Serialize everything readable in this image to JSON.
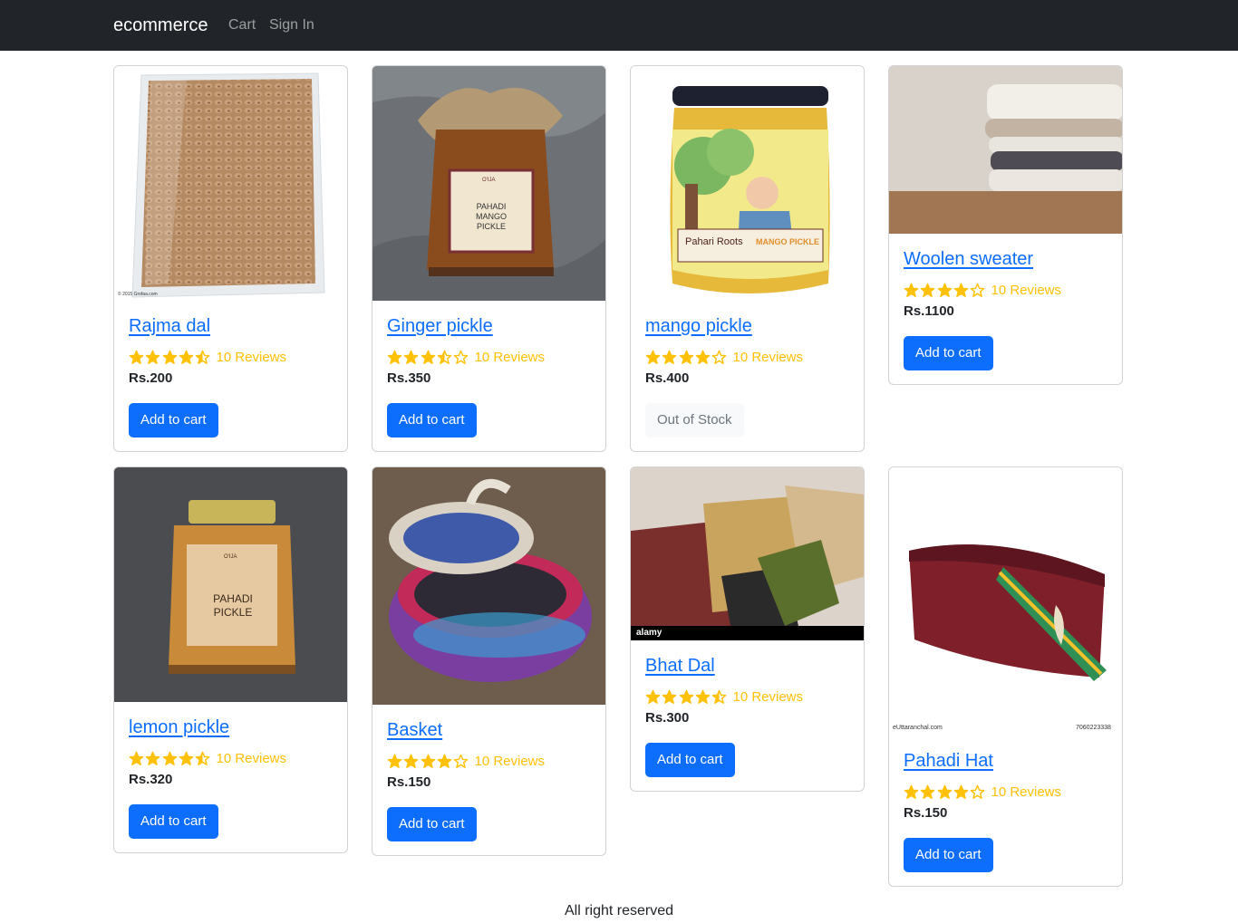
{
  "nav": {
    "brand": "ecommerce",
    "links": [
      "Cart",
      "Sign In"
    ]
  },
  "products": [
    {
      "title": "Rajma dal",
      "rating": 4.5,
      "reviews": "10 Reviews",
      "price": "Rs.200",
      "button": "Add to cart",
      "in_stock": true,
      "image": "rajma-dal-image"
    },
    {
      "title": "Ginger pickle",
      "rating": 3.5,
      "reviews": "10 Reviews",
      "price": "Rs.350",
      "button": "Add to cart",
      "in_stock": true,
      "image": "ginger-pickle-image"
    },
    {
      "title": "mango pickle",
      "rating": 4,
      "reviews": "10 Reviews",
      "price": "Rs.400",
      "button": "Out of Stock",
      "in_stock": false,
      "image": "mango-pickle-image"
    },
    {
      "title": "Woolen sweater",
      "rating": 4,
      "reviews": "10 Reviews",
      "price": "Rs.1100",
      "button": "Add to cart",
      "in_stock": true,
      "image": "woolen-sweater-image"
    },
    {
      "title": "lemon pickle",
      "rating": 4.5,
      "reviews": "10 Reviews",
      "price": "Rs.320",
      "button": "Add to cart",
      "in_stock": true,
      "image": "lemon-pickle-image"
    },
    {
      "title": "Basket",
      "rating": 4,
      "reviews": "10 Reviews",
      "price": "Rs.150",
      "button": "Add to cart",
      "in_stock": true,
      "image": "basket-image"
    },
    {
      "title": "Bhat Dal",
      "rating": 4.5,
      "reviews": "10 Reviews",
      "price": "Rs.300",
      "button": "Add to cart",
      "in_stock": true,
      "image": "bhat-dal-image"
    },
    {
      "title": "Pahadi Hat",
      "rating": 4,
      "reviews": "10 Reviews",
      "price": "Rs.150",
      "button": "Add to cart",
      "in_stock": true,
      "image": "pahadi-hat-image"
    }
  ],
  "image_text": {
    "rajma": "© 2015 Grofaa.com",
    "jar_brand": "O'IJA",
    "ginger_label": "PAHADI MANGO PICKLE",
    "mango_brand": "Pahari Roots",
    "mango_label": "MANGO PICKLE",
    "lemon_label": "PAHADI PICKLE",
    "alamy": "alamy",
    "hat_site": "eUttaranchal.com",
    "hat_phone": "7060223338"
  },
  "colors": {
    "navbar": "#212529",
    "primary": "#0d6efd",
    "star": "#ffc107"
  },
  "footer": "All right reserved"
}
